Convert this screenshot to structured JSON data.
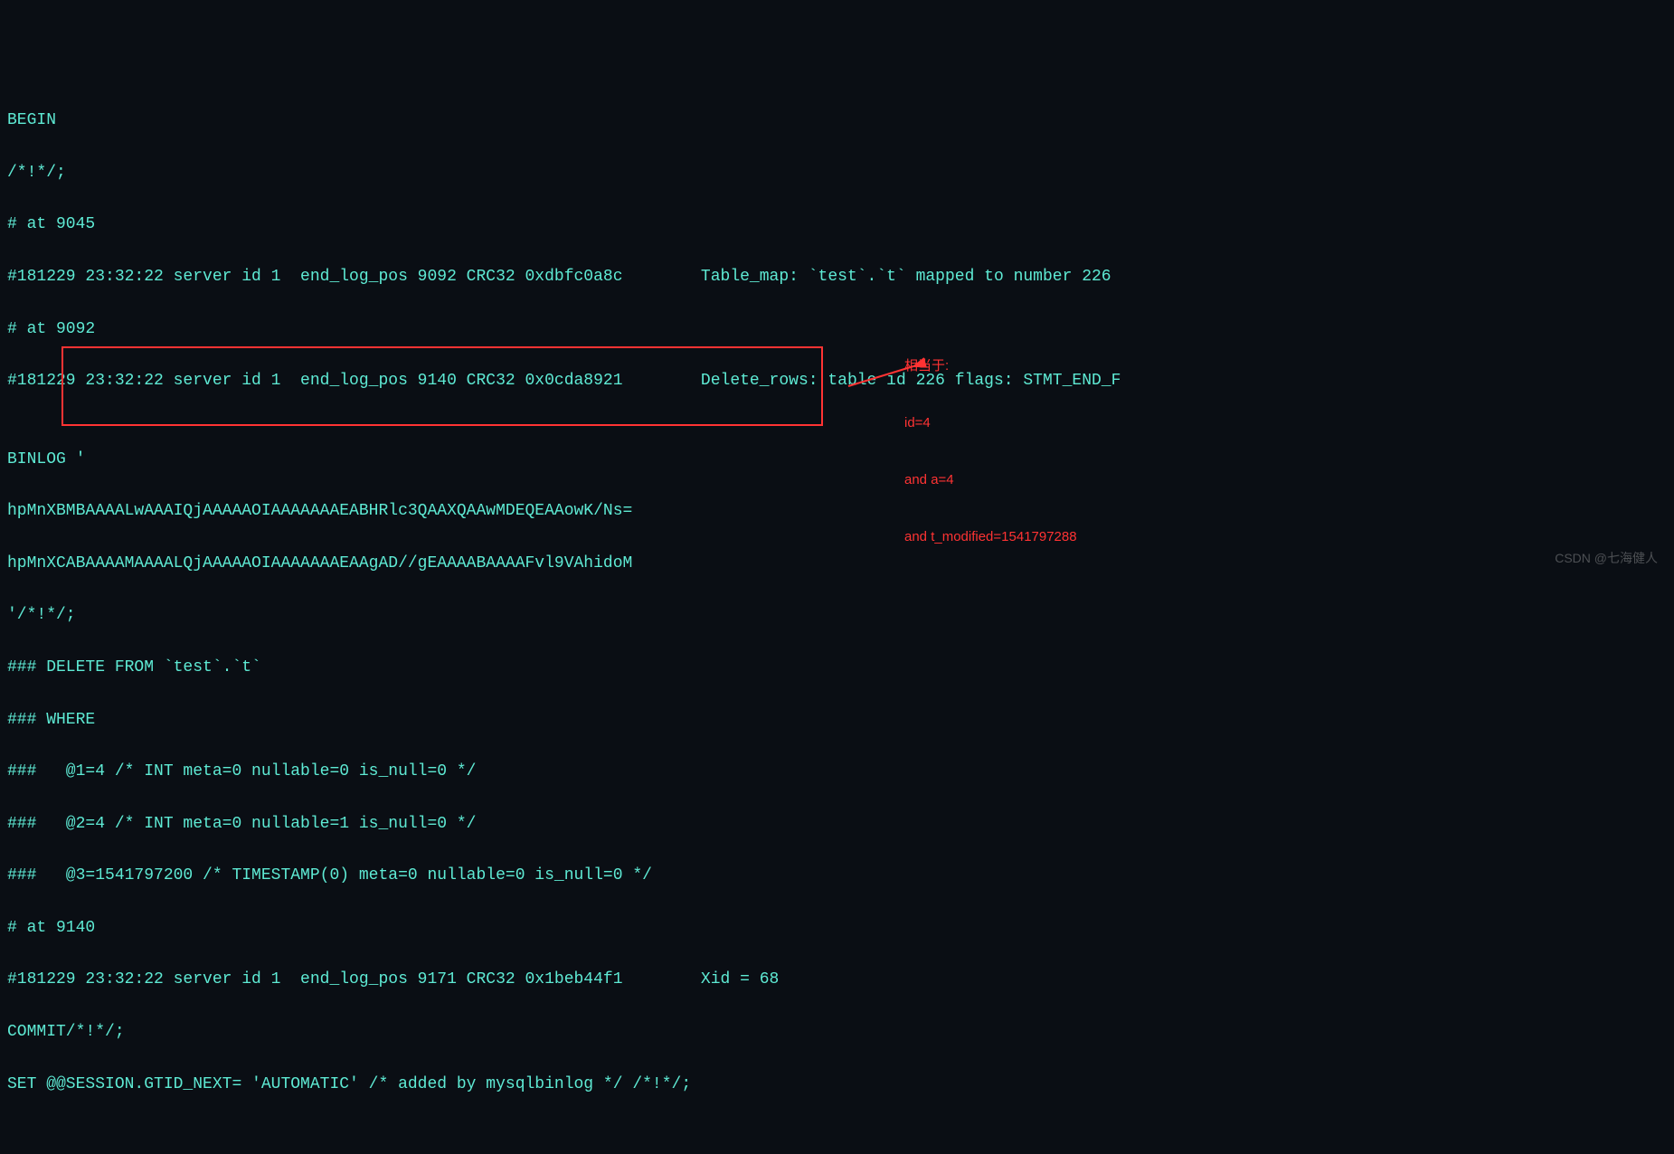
{
  "lines": [
    "BEGIN",
    "/*!*/;",
    "# at 9045",
    "#181229 23:32:22 server id 1  end_log_pos 9092 CRC32 0xdbfc0a8c        Table_map: `test`.`t` mapped to number 226",
    "# at 9092",
    "#181229 23:32:22 server id 1  end_log_pos 9140 CRC32 0x0cda8921        Delete_rows: table id 226 flags: STMT_END_F",
    "",
    "BINLOG '",
    "hpMnXBMBAAAALwAAAIQjAAAAAOIAAAAAAAEABHRlc3QAAXQAAwMDEQEAAowK/Ns=",
    "hpMnXCABAAAAMAAAALQjAAAAAOIAAAAAAAEAAgAD//gEAAAABAAAAFvl9VAhidoM",
    "'/*!*/;",
    "### DELETE FROM `test`.`t`",
    "### WHERE",
    "###   @1=4 /* INT meta=0 nullable=0 is_null=0 */",
    "###   @2=4 /* INT meta=0 nullable=1 is_null=0 */",
    "###   @3=1541797200 /* TIMESTAMP(0) meta=0 nullable=0 is_null=0 */",
    "# at 9140",
    "#181229 23:32:22 server id 1  end_log_pos 9171 CRC32 0x1beb44f1        Xid = 68",
    "COMMIT/*!*/;",
    "SET @@SESSION.GTID_NEXT= 'AUTOMATIC' /* added by mysqlbinlog */ /*!*/;"
  ],
  "annotation": {
    "label1": "相当于:",
    "label2": "id=4",
    "label3": "and a=4",
    "label4": "and t_modified=1541797288"
  },
  "watermark": "CSDN @七海健人"
}
